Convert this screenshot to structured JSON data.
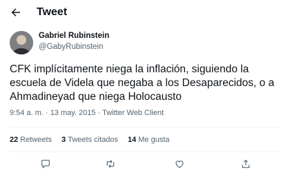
{
  "header": {
    "title": "Tweet"
  },
  "author": {
    "name": "Gabriel Rubinstein",
    "handle": "@GabyRubinstein"
  },
  "tweet": {
    "text": "CFK implícitamente niega la inflación, siguiendo la escuela de Videla que negaba a los Desaparecidos, o a Ahmadineyad que niega Holocausto",
    "meta": "9:54 a. m. · 13 may. 2015 · Twitter Web Client"
  },
  "stats": {
    "retweets_count": "22",
    "retweets_label": "Retweets",
    "quotes_count": "3",
    "quotes_label": "Tweets citados",
    "likes_count": "14",
    "likes_label": "Me gusta"
  },
  "icons": {
    "back": "arrow-left-icon",
    "reply": "comment-icon",
    "retweet": "retweet-icon",
    "like": "heart-icon",
    "share": "share-icon"
  },
  "colors": {
    "text": "#0f1419",
    "secondary": "#536471",
    "divider": "#eff3f4"
  }
}
